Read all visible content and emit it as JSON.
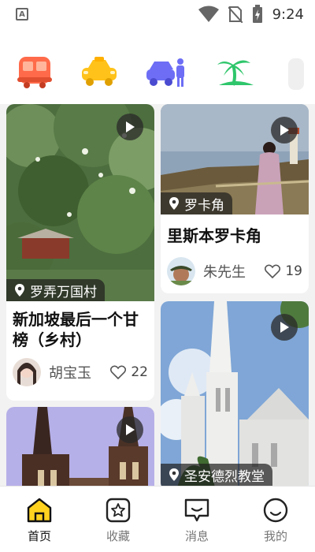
{
  "status": {
    "time": "9:24",
    "app_icon_letter": "A"
  },
  "categories": [
    {
      "icon": "bus-icon",
      "color": "#ff6b4a"
    },
    {
      "icon": "taxi-car-icon",
      "color": "#ffc21a"
    },
    {
      "icon": "self-drive-car-icon",
      "color": "#6d6ef5"
    },
    {
      "icon": "island-palm-icon",
      "color": "#2fc66b"
    }
  ],
  "feed": {
    "left": [
      {
        "location": "罗弄万国村",
        "title": "新加坡最后一个甘榜（乡村）",
        "author": "胡宝玉",
        "likes": "22"
      },
      {
        "location": "",
        "title": "",
        "author": "",
        "likes": ""
      }
    ],
    "right": [
      {
        "location": "罗卡角",
        "title": "里斯本罗卡角",
        "author": "朱先生",
        "likes": "19"
      },
      {
        "location": "圣安德烈教堂",
        "title": "",
        "author": "",
        "likes": ""
      }
    ]
  },
  "tabs": [
    {
      "label": "首页",
      "icon": "home-icon",
      "active": true
    },
    {
      "label": "收藏",
      "icon": "favorites-star-icon",
      "active": false
    },
    {
      "label": "消息",
      "icon": "message-icon",
      "active": false
    },
    {
      "label": "我的",
      "icon": "profile-smile-icon",
      "active": false
    }
  ],
  "colors": {
    "accent": "#ffd21f",
    "background": "#f2f2f2"
  }
}
